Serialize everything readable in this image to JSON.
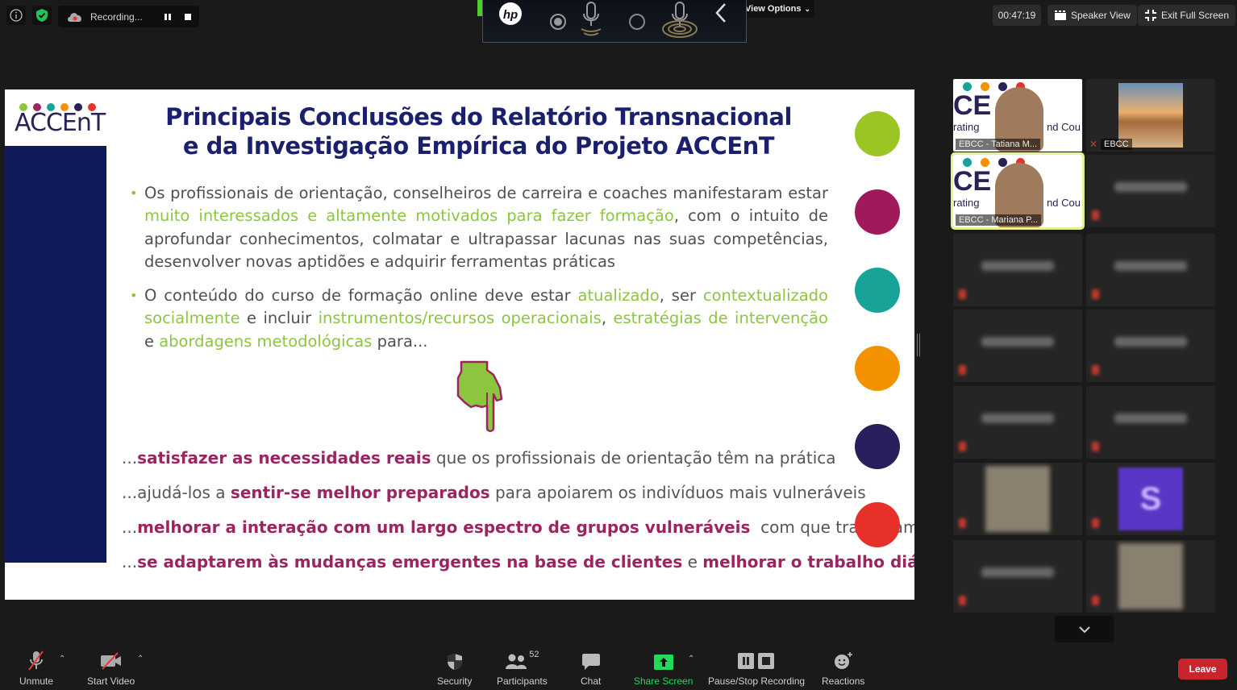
{
  "topbar": {
    "info_icon": "info-icon",
    "security_icon": "shield-check-icon",
    "recording_label": "Recording...",
    "recording_pause_icon": "pause-icon",
    "recording_stop_icon": "stop-icon",
    "view_options_label": "View Options",
    "timer": "00:47:19",
    "speaker_view_label": "Speaker View",
    "exit_fullscreen_label": "Exit Full Screen"
  },
  "hp_overlay": {
    "logo": "hp",
    "icons": [
      "record-dot-icon",
      "mic-icon",
      "circle-icon",
      "mic-waves-icon",
      "chevron-left-icon"
    ]
  },
  "slide": {
    "logo_text": "ACCEnT",
    "logo_dot_colors": [
      "#8cc63f",
      "#9c2461",
      "#17a398",
      "#f39200",
      "#2a2256",
      "#e63329"
    ],
    "title_line1": "Principais Conclusões do Relatório Transnacional",
    "title_line2": "e da Investigação Empírica do Projeto ACCEnT",
    "bullet1": {
      "a": "Os profissionais de orientação, conselheiros de carreira e coaches manifestaram estar ",
      "b": "muito interessados e altamente motivados para fazer formação",
      "c": ", com o intuito de aprofundar conhecimentos, colmatar e ultrapassar lacunas nas suas competências, desenvolver novas aptidões e adquirir ferramentas práticas"
    },
    "bullet2": {
      "a": "O conteúdo do curso de formação online deve estar ",
      "b": "atualizado",
      "c": ", ser ",
      "d": "contextualizado socialmente",
      "e": " e incluir ",
      "f": "instrumentos/recursos operacionais",
      "g": ", ",
      "h": "estratégias de intervenção",
      "i": " e ",
      "j": "abordagens metodológicas",
      "k": " para..."
    },
    "hand_icon": "pointing-down-hand-icon",
    "conclusions": [
      {
        "pre": "...",
        "bold": "satisfazer as necessidades reais",
        "post": " que os profissionais de orientação têm na prática"
      },
      {
        "pre": "...ajudá-los a ",
        "bold": "sentir-se melhor preparados",
        "post": " para apoiarem os indivíduos mais vulneráveis"
      },
      {
        "pre": "...",
        "bold": "melhorar a interação com um largo espectro de grupos vulneráveis",
        "post": "  com que trabalham"
      },
      {
        "pre": "...",
        "bold": "se adaptarem às mudanças emergentes na base de clientes",
        "mid": " e ",
        "bold2": "melhorar o trabalho diário"
      }
    ],
    "side_dot_colors": [
      "#9bc523",
      "#a0195a",
      "#17a398",
      "#f39200",
      "#2a1f5c",
      "#e8302a"
    ]
  },
  "gallery": {
    "tiles": [
      {
        "name": "EBCC - Tatiana M...",
        "type": "video"
      },
      {
        "name": "EBCC",
        "type": "photo",
        "muted": true
      },
      {
        "name": "EBCC - Mariana P...",
        "type": "video",
        "active": true
      },
      {
        "name": "",
        "type": "blurred"
      },
      {
        "name": "",
        "type": "blurred"
      },
      {
        "name": "",
        "type": "blurred"
      },
      {
        "name": "",
        "type": "blurred"
      },
      {
        "name": "",
        "type": "blurred"
      },
      {
        "name": "",
        "type": "blurred"
      },
      {
        "name": "",
        "type": "blurred"
      },
      {
        "name": "",
        "type": "blurred-photo"
      },
      {
        "name": "",
        "type": "blurred-avatar",
        "avatar_letter": "S"
      },
      {
        "name": "",
        "type": "blurred"
      },
      {
        "name": "",
        "type": "blurred-photo"
      }
    ],
    "scroll_icon": "chevron-down-icon"
  },
  "toolbar": {
    "unmute": "Unmute",
    "start_video": "Start Video",
    "security": "Security",
    "participants": "Participants",
    "participants_count": "52",
    "chat": "Chat",
    "share_screen": "Share Screen",
    "pause_stop_recording": "Pause/Stop Recording",
    "reactions": "Reactions",
    "leave": "Leave",
    "share_color": "#23d959",
    "leave_color": "#c8252c"
  }
}
